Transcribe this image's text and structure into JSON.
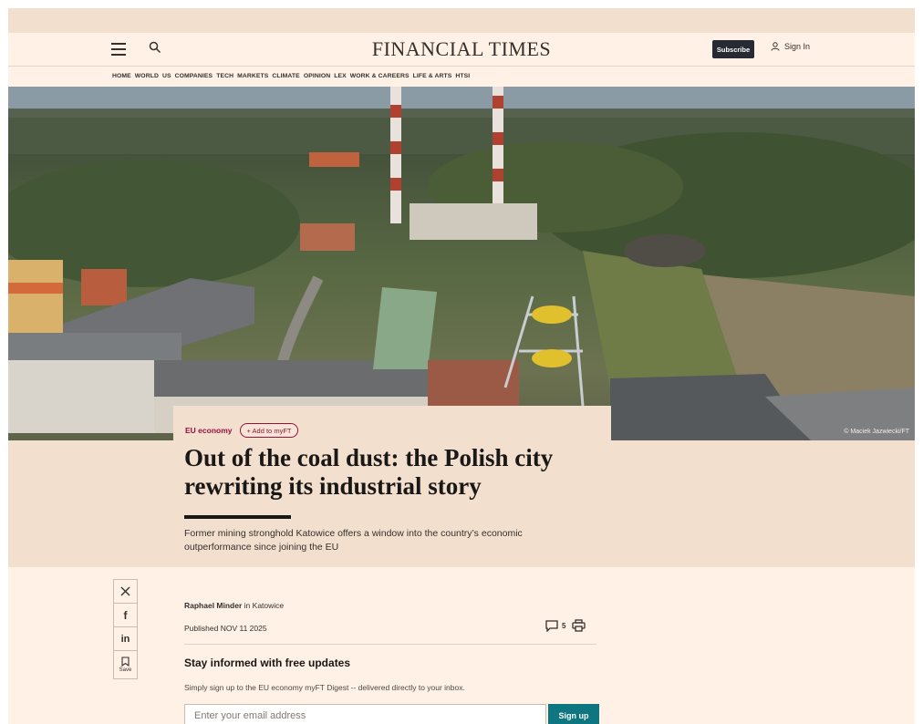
{
  "header": {
    "masthead": "FINANCIAL TIMES",
    "subscribe_label": "Subscribe",
    "signin_label": "Sign In",
    "menu_icon": "hamburger-icon",
    "search_icon": "search-icon"
  },
  "nav": {
    "items": [
      "HOME",
      "WORLD",
      "US",
      "COMPANIES",
      "TECH",
      "MARKETS",
      "CLIMATE",
      "OPINION",
      "LEX",
      "WORK & CAREERS",
      "LIFE & ARTS",
      "HTSI"
    ]
  },
  "hero": {
    "photo_credit": "© Maciek Jazwiecki/FT"
  },
  "article": {
    "topic": "EU economy",
    "add_myft_label": "+ Add to myFT",
    "headline": "Out of the coal dust: the Polish city rewriting its industrial story",
    "standfirst": "Former mining stronghold Katowice offers a window into the country’s economic outperformance since joining the EU",
    "author": "Raphael Minder",
    "location": "in Katowice",
    "published": "Published NOV 11 2025",
    "comment_count": "5"
  },
  "share": {
    "save_label": "Save",
    "icons": [
      "x-icon",
      "facebook-icon",
      "linkedin-icon",
      "bookmark-icon"
    ]
  },
  "signup": {
    "heading": "Stay informed with free updates",
    "text": "Simply sign up to the EU economy myFT Digest -- delivered directly to your inbox.",
    "placeholder": "Enter your email address",
    "button_label": "Sign up"
  },
  "colors": {
    "page_bg": "#fff1e5",
    "topic_accent": "#990f3d",
    "signup_button": "#0d7680",
    "subscribe_button": "#262a33"
  }
}
